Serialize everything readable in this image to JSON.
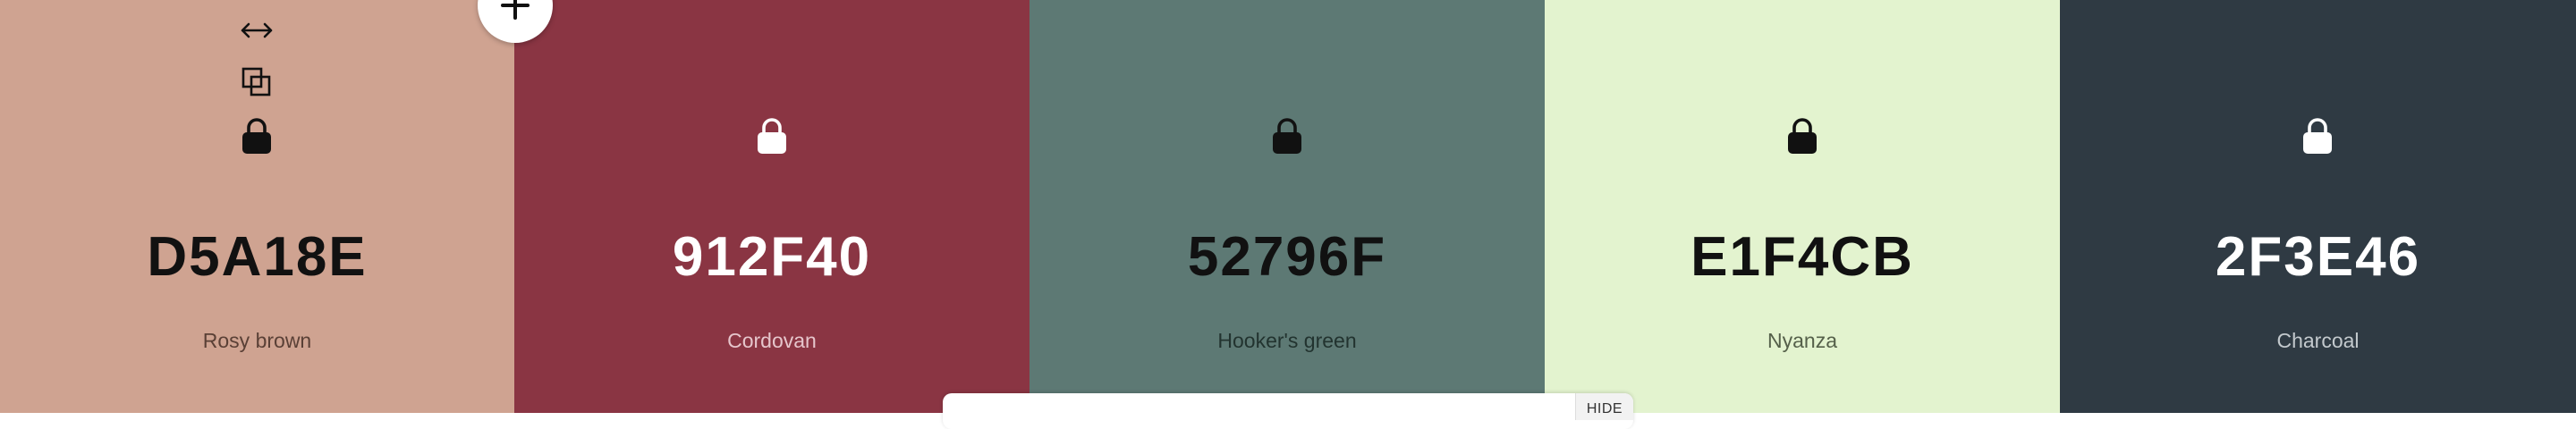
{
  "swatches": [
    {
      "hex": "D5A18E",
      "name": "Rosy brown",
      "bg": "#cfa391",
      "fg": "#111111",
      "sub": "#5a4036"
    },
    {
      "hex": "912F40",
      "name": "Cordovan",
      "bg": "#8a3543",
      "fg": "#ffffff",
      "sub": "#e6c6cc"
    },
    {
      "hex": "52796F",
      "name": "Hooker's green",
      "bg": "#5d7974",
      "fg": "#111111",
      "sub": "#22332f"
    },
    {
      "hex": "E1F4CB",
      "name": "Nyanza",
      "bg": "#e3f3cf",
      "fg": "#111111",
      "sub": "#55604a"
    },
    {
      "hex": "2F3E46",
      "name": "Charcoal",
      "bg": "#2f3a43",
      "fg": "#ffffff",
      "sub": "#c3c9cd"
    }
  ],
  "bottom_bar": {
    "hide_label": "HIDE"
  }
}
